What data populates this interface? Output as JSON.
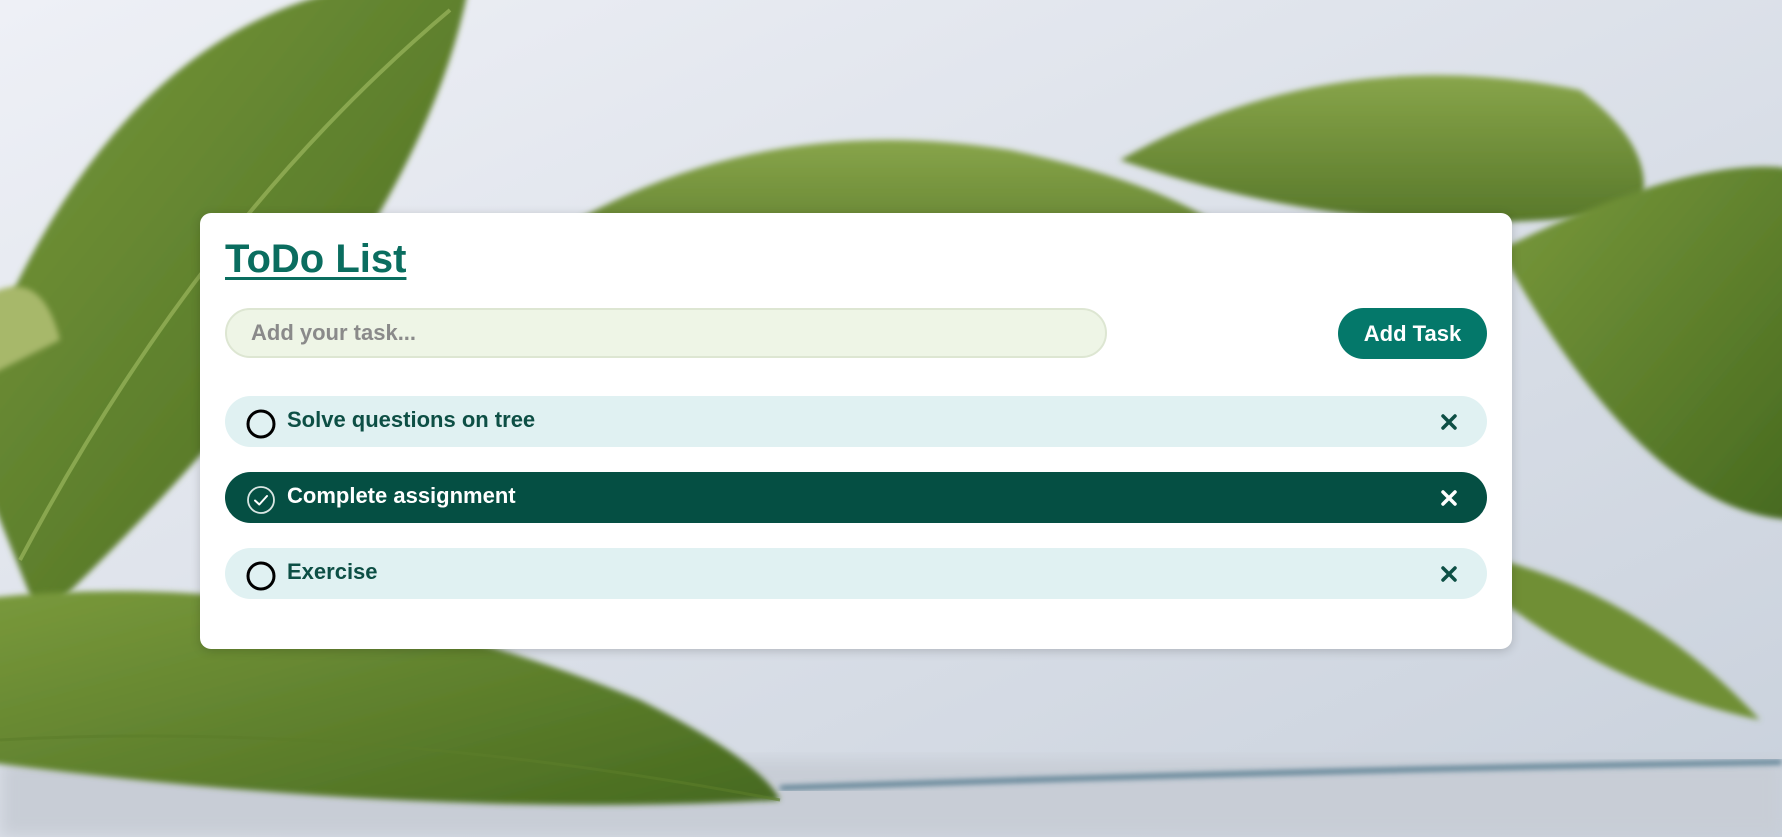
{
  "app": {
    "title": "ToDo List"
  },
  "input": {
    "placeholder": "Add your task...",
    "value": ""
  },
  "add_button": {
    "label": "Add Task"
  },
  "tasks": [
    {
      "label": "Solve questions on tree",
      "done": false
    },
    {
      "label": "Complete assignment",
      "done": true
    },
    {
      "label": "Exercise",
      "done": false
    }
  ],
  "icons": {
    "unchecked": "circle-icon",
    "checked": "check-circle-icon",
    "delete": "close-icon"
  },
  "colors": {
    "accent": "#04786a",
    "title": "#0a6d5f",
    "task_bg": "#e0f1f2",
    "task_done_bg": "#054f43",
    "task_text": "#0d4f45",
    "input_bg": "#eef5e6"
  }
}
